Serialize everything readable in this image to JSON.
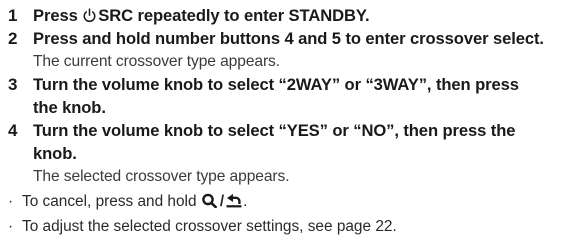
{
  "steps": [
    {
      "number": "1",
      "text_prefix": "Press ",
      "icon": "power-icon",
      "text": "SRC repeatedly to enter STANDBY."
    },
    {
      "number": "2",
      "text": "Press and hold number buttons 4 and 5 to enter crossover select.",
      "note": "The current crossover type appears."
    },
    {
      "number": "3",
      "text_line1": "Turn the volume knob to select “2WAY” or “3WAY”, then press",
      "text_line2": "the knob."
    },
    {
      "number": "4",
      "text_line1": "Turn the volume knob to select “YES” or “NO”, then press the",
      "text_line2": "knob.",
      "note": "The selected crossover type appears."
    }
  ],
  "bullets": [
    {
      "marker": "·",
      "text": "To cancel, press and hold ",
      "icons": [
        "search-icon",
        "back-icon"
      ],
      "suffix": "."
    },
    {
      "marker": "·",
      "text": "To adjust the selected crossover settings, see page 22."
    }
  ]
}
